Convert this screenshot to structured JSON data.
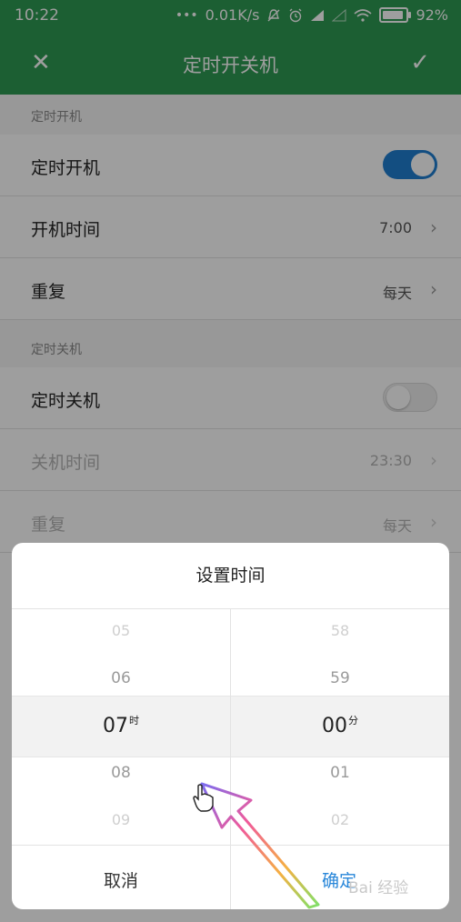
{
  "statusbar": {
    "time": "10:22",
    "network_speed": "0.01K/s",
    "battery_percent": "92%",
    "battery_level": 0.92,
    "icons": [
      "dots-icon",
      "mute-bell-icon",
      "alarm-icon",
      "signal-icon",
      "signal-weak-icon",
      "wifi-icon",
      "battery-icon"
    ]
  },
  "toolbar": {
    "title": "定时开关机",
    "close_glyph": "✕",
    "confirm_glyph": "✓"
  },
  "power_on": {
    "section_label": "定时开机",
    "toggle_label": "定时开机",
    "toggle_on": true,
    "time_label": "开机时间",
    "time_value": "7:00",
    "repeat_label": "重复",
    "repeat_value": "每天"
  },
  "power_off": {
    "section_label": "定时关机",
    "toggle_label": "定时关机",
    "toggle_on": false,
    "time_label": "关机时间",
    "time_value": "23:30",
    "repeat_label": "重复",
    "repeat_value": "每天"
  },
  "chevron_glyph": "›",
  "dialog": {
    "title": "设置时间",
    "hours": [
      "05",
      "06",
      "07",
      "08",
      "09"
    ],
    "minutes": [
      "58",
      "59",
      "00",
      "01",
      "02"
    ],
    "hour_unit": "时",
    "minute_unit": "分",
    "cancel_label": "取消",
    "confirm_label": "确定"
  },
  "colors": {
    "accent_green": "#2e9a53",
    "toggle_blue": "#1f7ed1",
    "confirm_blue": "#2786d9"
  },
  "watermark": "Bai 经验"
}
